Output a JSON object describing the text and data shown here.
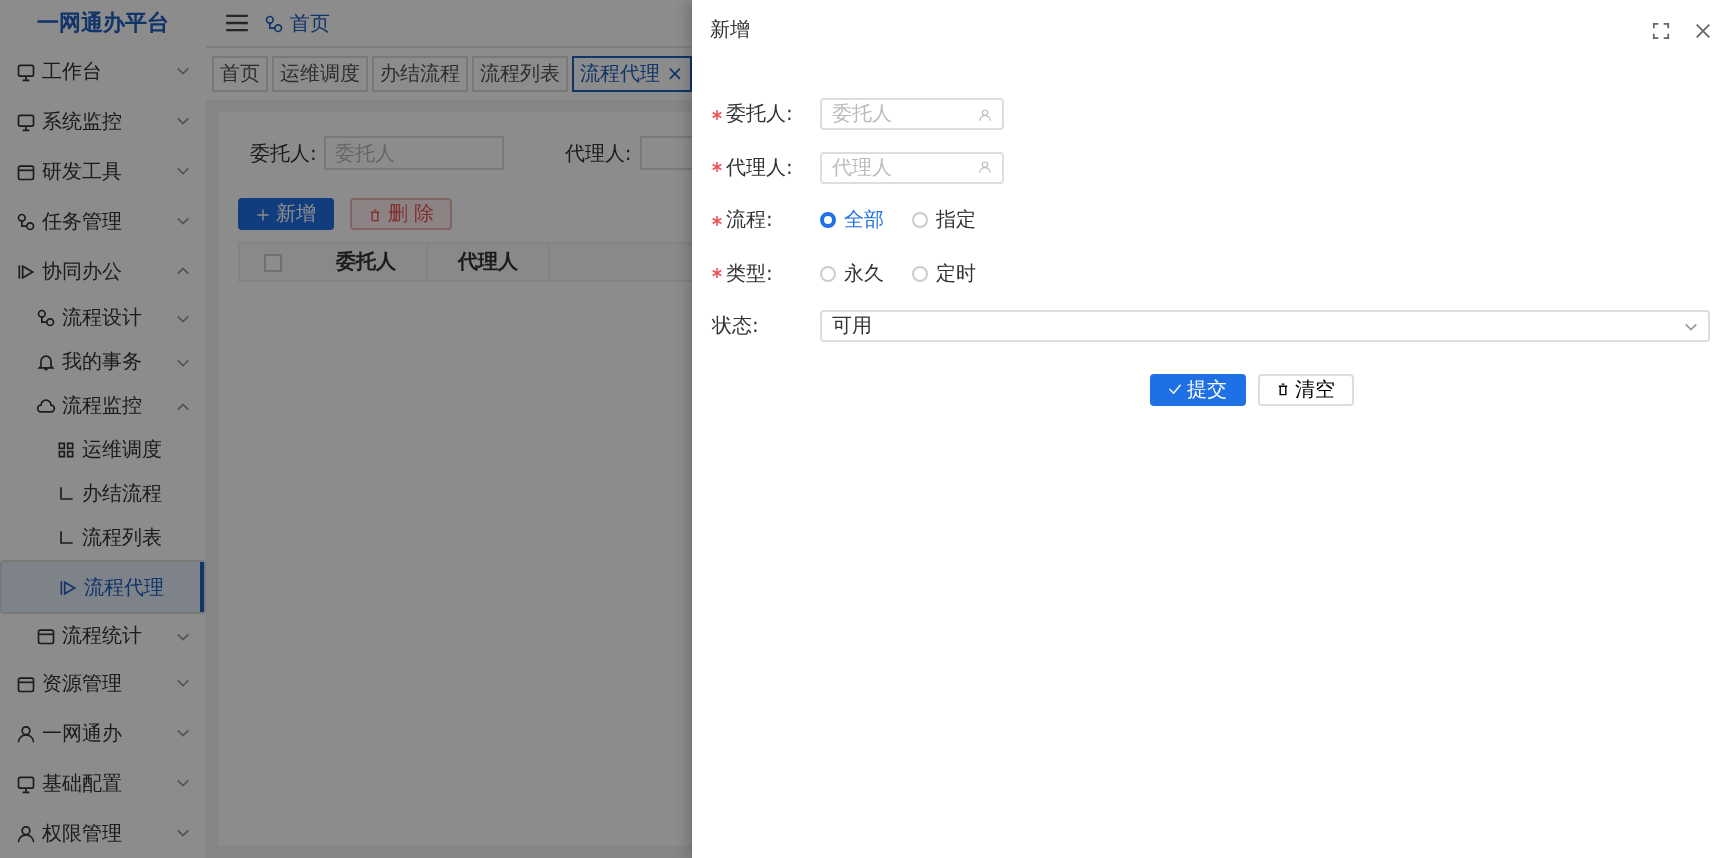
{
  "logo": "一网通办平台",
  "header": {
    "breadcrumb": "首页"
  },
  "sidebar": {
    "items": [
      {
        "label": "工作台",
        "expanded": false,
        "selected": false
      },
      {
        "label": "系统监控",
        "expanded": false,
        "selected": false
      },
      {
        "label": "研发工具",
        "expanded": false,
        "selected": false
      },
      {
        "label": "任务管理",
        "expanded": false,
        "selected": false
      },
      {
        "label": "协同办公",
        "expanded": true,
        "selected": false,
        "children": [
          {
            "label": "流程设计",
            "expanded": false,
            "selected": false
          },
          {
            "label": "我的事务",
            "expanded": false,
            "selected": false
          },
          {
            "label": "流程监控",
            "expanded": true,
            "selected": false,
            "children": [
              {
                "label": "运维调度",
                "selected": false
              },
              {
                "label": "办结流程",
                "selected": false
              },
              {
                "label": "流程列表",
                "selected": false
              },
              {
                "label": "流程代理",
                "selected": true
              }
            ]
          },
          {
            "label": "流程统计",
            "expanded": false,
            "selected": false
          }
        ]
      },
      {
        "label": "资源管理",
        "expanded": false,
        "selected": false
      },
      {
        "label": "一网通办",
        "expanded": false,
        "selected": false
      },
      {
        "label": "基础配置",
        "expanded": false,
        "selected": false
      },
      {
        "label": "权限管理",
        "expanded": false,
        "selected": false
      }
    ]
  },
  "tabs": [
    {
      "label": "首页",
      "selected": false
    },
    {
      "label": "运维调度",
      "selected": false
    },
    {
      "label": "办结流程",
      "selected": false
    },
    {
      "label": "流程列表",
      "selected": false
    },
    {
      "label": "流程代理",
      "selected": true,
      "close": "×"
    }
  ],
  "search": {
    "fields": [
      {
        "label": "委托人:",
        "placeholder": "委托人"
      },
      {
        "label": "代理人:"
      }
    ]
  },
  "toolbar": [
    {
      "label": "新增",
      "kind": "primary"
    },
    {
      "label": "删 除",
      "kind": "danger"
    }
  ],
  "table": {
    "columns": [
      "委托人",
      "代理人"
    ]
  },
  "drawer": {
    "title": "新增",
    "fields": [
      {
        "kind": "input",
        "label": "委托人:",
        "required": true,
        "placeholder": "委托人"
      },
      {
        "kind": "input",
        "label": "代理人:",
        "required": true,
        "placeholder": "代理人"
      },
      {
        "kind": "radio",
        "label": "流程:",
        "required": true,
        "options": [
          {
            "label": "全部",
            "selected": true
          },
          {
            "label": "指定",
            "selected": false
          }
        ]
      },
      {
        "kind": "radio",
        "label": "类型:",
        "required": true,
        "options": [
          {
            "label": "永久",
            "selected": false
          },
          {
            "label": "定时",
            "selected": false
          }
        ]
      },
      {
        "kind": "select",
        "label": "状态:",
        "required": false,
        "value": "可用"
      }
    ],
    "buttons": [
      {
        "label": "提交",
        "kind": "primary"
      },
      {
        "label": "清空",
        "kind": "default"
      }
    ]
  }
}
